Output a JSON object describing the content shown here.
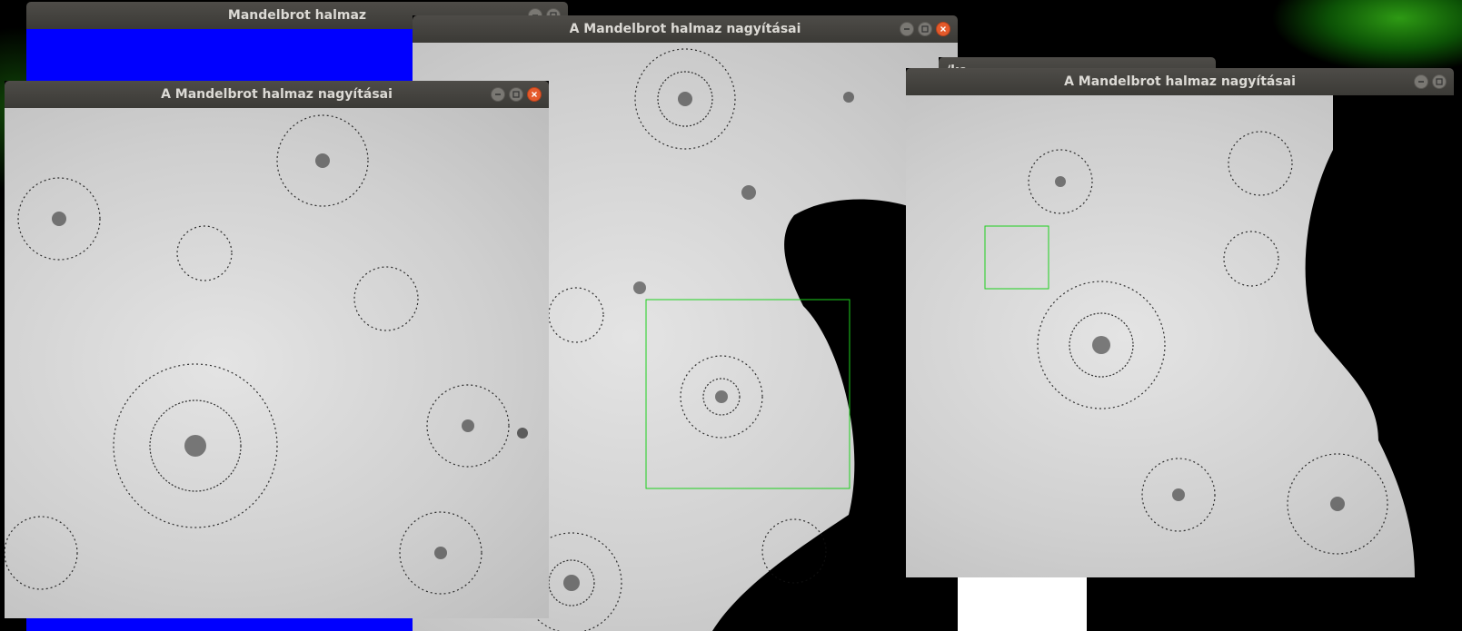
{
  "windows": [
    {
      "id": "w1",
      "title": "Mandelbrot halmaz"
    },
    {
      "id": "w2",
      "title": "A Mandelbrot halmaz nagyításai"
    },
    {
      "id": "w3",
      "title": "A Mandelbrot halmaz nagyításai"
    },
    {
      "id": "w4",
      "title": "A Mandelbrot halmaz nagyításai"
    }
  ],
  "hidden_window_title_fragment": "/ko",
  "colors": {
    "titlebar": "#3f3e3a",
    "title_text": "#dcdad5",
    "close_button": "#e45a2b",
    "zoom_rect": "#1ed01e",
    "mandelbrot_fill": "#0000ff"
  },
  "icons": [
    "minimize-icon",
    "maximize-icon",
    "close-icon"
  ]
}
